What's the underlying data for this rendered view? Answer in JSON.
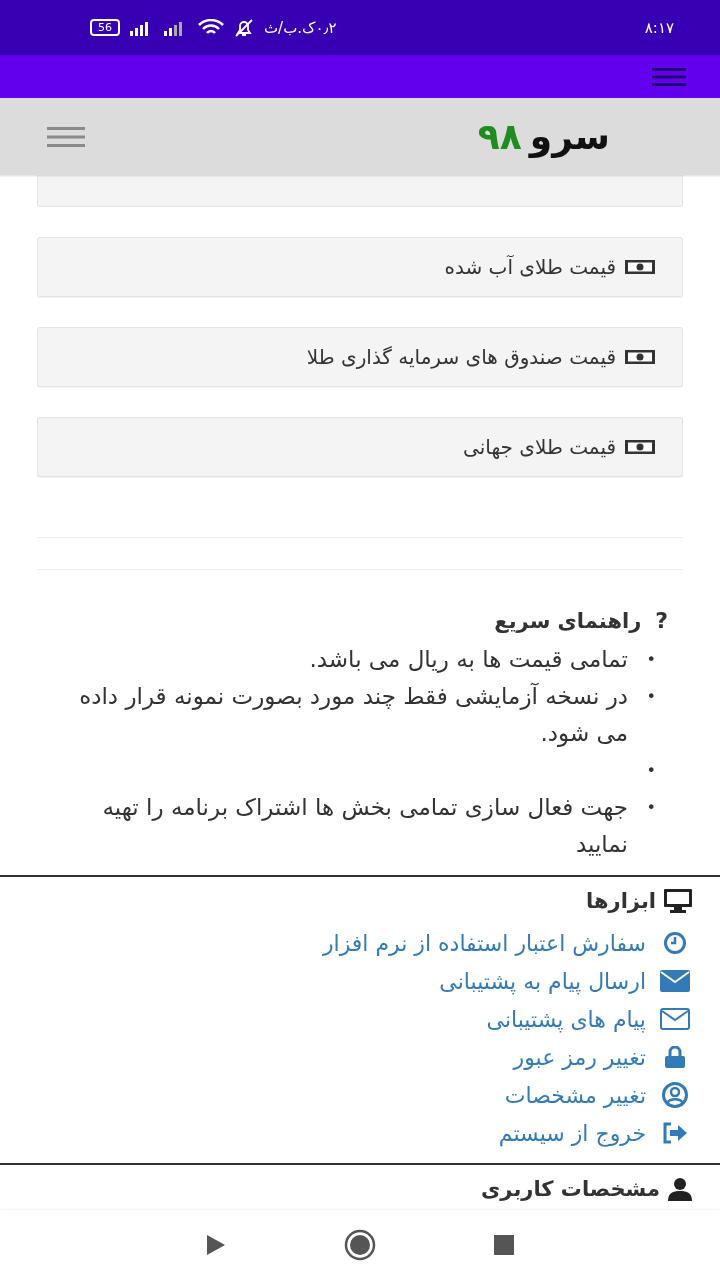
{
  "status_bar": {
    "time": "۸:۱۷",
    "speed": "۰٫۲ک.ب/ث",
    "battery": "56"
  },
  "site_header": {
    "logo_word": "سرو",
    "logo_number": "۹۸"
  },
  "price_cards": [
    {
      "label": "قیمت طلای آب شده"
    },
    {
      "label": "قیمت صندوق های سرمایه گذاری طلا"
    },
    {
      "label": "قیمت طلای جهانی"
    }
  ],
  "help": {
    "icon": "?",
    "title": "راهنمای سریع",
    "items": [
      {
        "kind": "text",
        "bullet": "•",
        "text": "تمامی قیمت ها به ریال می باشد."
      },
      {
        "kind": "text",
        "bullet": "•",
        "text": "در نسخه آزمایشی فقط چند مورد بصورت نمونه قرار داده می شود."
      },
      {
        "kind": "blank",
        "bullet": "•"
      },
      {
        "kind": "text",
        "bullet": "•",
        "text": "جهت فعال سازی تمامی بخش ها اشتراک برنامه را تهیه نمایید"
      }
    ]
  },
  "tools": {
    "title": "ابزارها",
    "links": [
      {
        "kind": "clock",
        "label": "سفارش اعتبار استفاده از نرم افزار"
      },
      {
        "kind": "envelope",
        "label": "ارسال پیام به پشتیبانی"
      },
      {
        "kind": "envelope-outline",
        "label": "پیام های پشتیبانی"
      },
      {
        "kind": "lock",
        "label": "تغییر رمز عبور"
      },
      {
        "kind": "user-circle",
        "label": "تغییر مشخصات"
      },
      {
        "kind": "sign-out",
        "label": "خروج از سیستم"
      }
    ]
  },
  "user_section": {
    "title": "مشخصات کاربری"
  }
}
